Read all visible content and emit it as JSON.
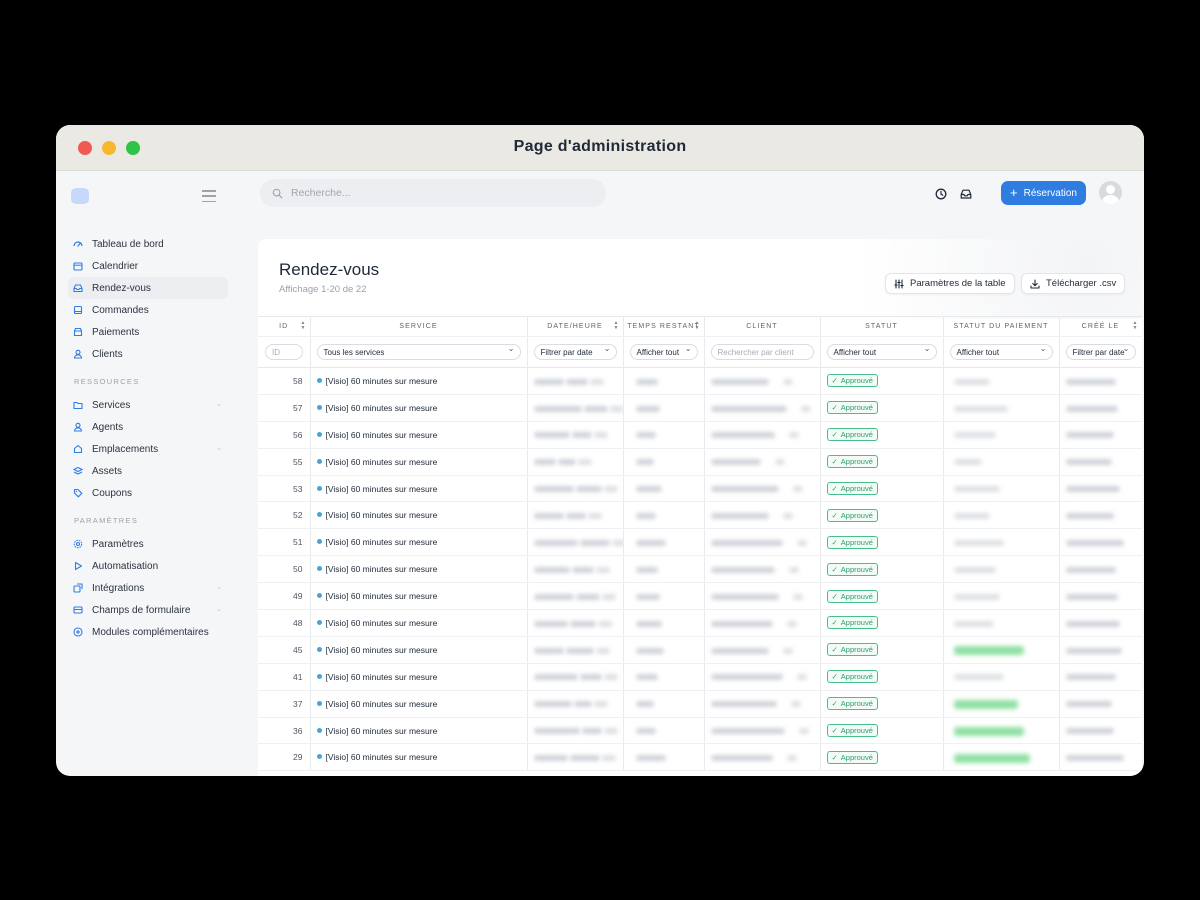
{
  "window": {
    "title": "Page d'administration"
  },
  "sidebar": {
    "main_items": [
      {
        "label": "Tableau de bord",
        "icon": "dashboard-icon"
      },
      {
        "label": "Calendrier",
        "icon": "calendar-icon"
      },
      {
        "label": "Rendez-vous",
        "icon": "inbox-icon",
        "active": true
      },
      {
        "label": "Commandes",
        "icon": "orders-icon"
      },
      {
        "label": "Paiements",
        "icon": "payments-icon"
      },
      {
        "label": "Clients",
        "icon": "user-icon"
      }
    ],
    "resources_heading": "RESSOURCES",
    "resources_items": [
      {
        "label": "Services",
        "icon": "folder-icon",
        "has_chevron": true
      },
      {
        "label": "Agents",
        "icon": "user-icon"
      },
      {
        "label": "Emplacements",
        "icon": "location-icon",
        "has_chevron": true
      },
      {
        "label": "Assets",
        "icon": "layers-icon"
      },
      {
        "label": "Coupons",
        "icon": "tag-icon"
      }
    ],
    "settings_heading": "PARAMÈTRES",
    "settings_items": [
      {
        "label": "Paramètres",
        "icon": "gear-icon"
      },
      {
        "label": "Automatisation",
        "icon": "play-icon"
      },
      {
        "label": "Intégrations",
        "icon": "integrations-icon",
        "has_chevron": true
      },
      {
        "label": "Champs de formulaire",
        "icon": "form-icon",
        "has_chevron": true
      },
      {
        "label": "Modules complémentaires",
        "icon": "plus-circle-icon"
      }
    ]
  },
  "topbar": {
    "search_placeholder": "Recherche...",
    "new_button": "Réservation",
    "accent_color": "#2f7de1"
  },
  "page": {
    "title": "Rendez-vous",
    "subtitle": "Affichage 1-20 de 22",
    "table_settings_button": "Paramètres de la table",
    "download_button": "Télécharger .csv"
  },
  "table": {
    "columns": [
      "ID",
      "SERVICE",
      "DATE/HEURE",
      "TEMPS RESTANT",
      "CLIENT",
      "STATUT",
      "STATUT DU PAIEMENT",
      "CRÉÉ LE"
    ],
    "filters": {
      "id_placeholder": "ID",
      "service": "Tous les services",
      "date": "Filtrer par date",
      "time_left": "Afficher tout",
      "client_placeholder": "Rechercher par client",
      "status": "Afficher tout",
      "payment_status": "Afficher tout",
      "created": "Filtrer par date"
    },
    "rows": [
      {
        "id": "58",
        "service": "[Visio] 60 minutes sur mesure",
        "status": "Approuvé"
      },
      {
        "id": "57",
        "service": "[Visio] 60 minutes sur mesure",
        "status": "Approuvé"
      },
      {
        "id": "56",
        "service": "[Visio] 60 minutes sur mesure",
        "status": "Approuvé"
      },
      {
        "id": "55",
        "service": "[Visio] 60 minutes sur mesure",
        "status": "Approuvé"
      },
      {
        "id": "53",
        "service": "[Visio] 60 minutes sur mesure",
        "status": "Approuvé"
      },
      {
        "id": "52",
        "service": "[Visio] 60 minutes sur mesure",
        "status": "Approuvé"
      },
      {
        "id": "51",
        "service": "[Visio] 60 minutes sur mesure",
        "status": "Approuvé"
      },
      {
        "id": "50",
        "service": "[Visio] 60 minutes sur mesure",
        "status": "Approuvé"
      },
      {
        "id": "49",
        "service": "[Visio] 60 minutes sur mesure",
        "status": "Approuvé"
      },
      {
        "id": "48",
        "service": "[Visio] 60 minutes sur mesure",
        "status": "Approuvé"
      },
      {
        "id": "45",
        "service": "[Visio] 60 minutes sur mesure",
        "status": "Approuvé"
      },
      {
        "id": "41",
        "service": "[Visio] 60 minutes sur mesure",
        "status": "Approuvé"
      },
      {
        "id": "37",
        "service": "[Visio] 60 minutes sur mesure",
        "status": "Approuvé"
      },
      {
        "id": "36",
        "service": "[Visio] 60 minutes sur mesure",
        "status": "Approuvé"
      },
      {
        "id": "29",
        "service": "[Visio] 60 minutes sur mesure",
        "status": "Approuvé"
      }
    ],
    "status_color": "#2d9d69"
  }
}
